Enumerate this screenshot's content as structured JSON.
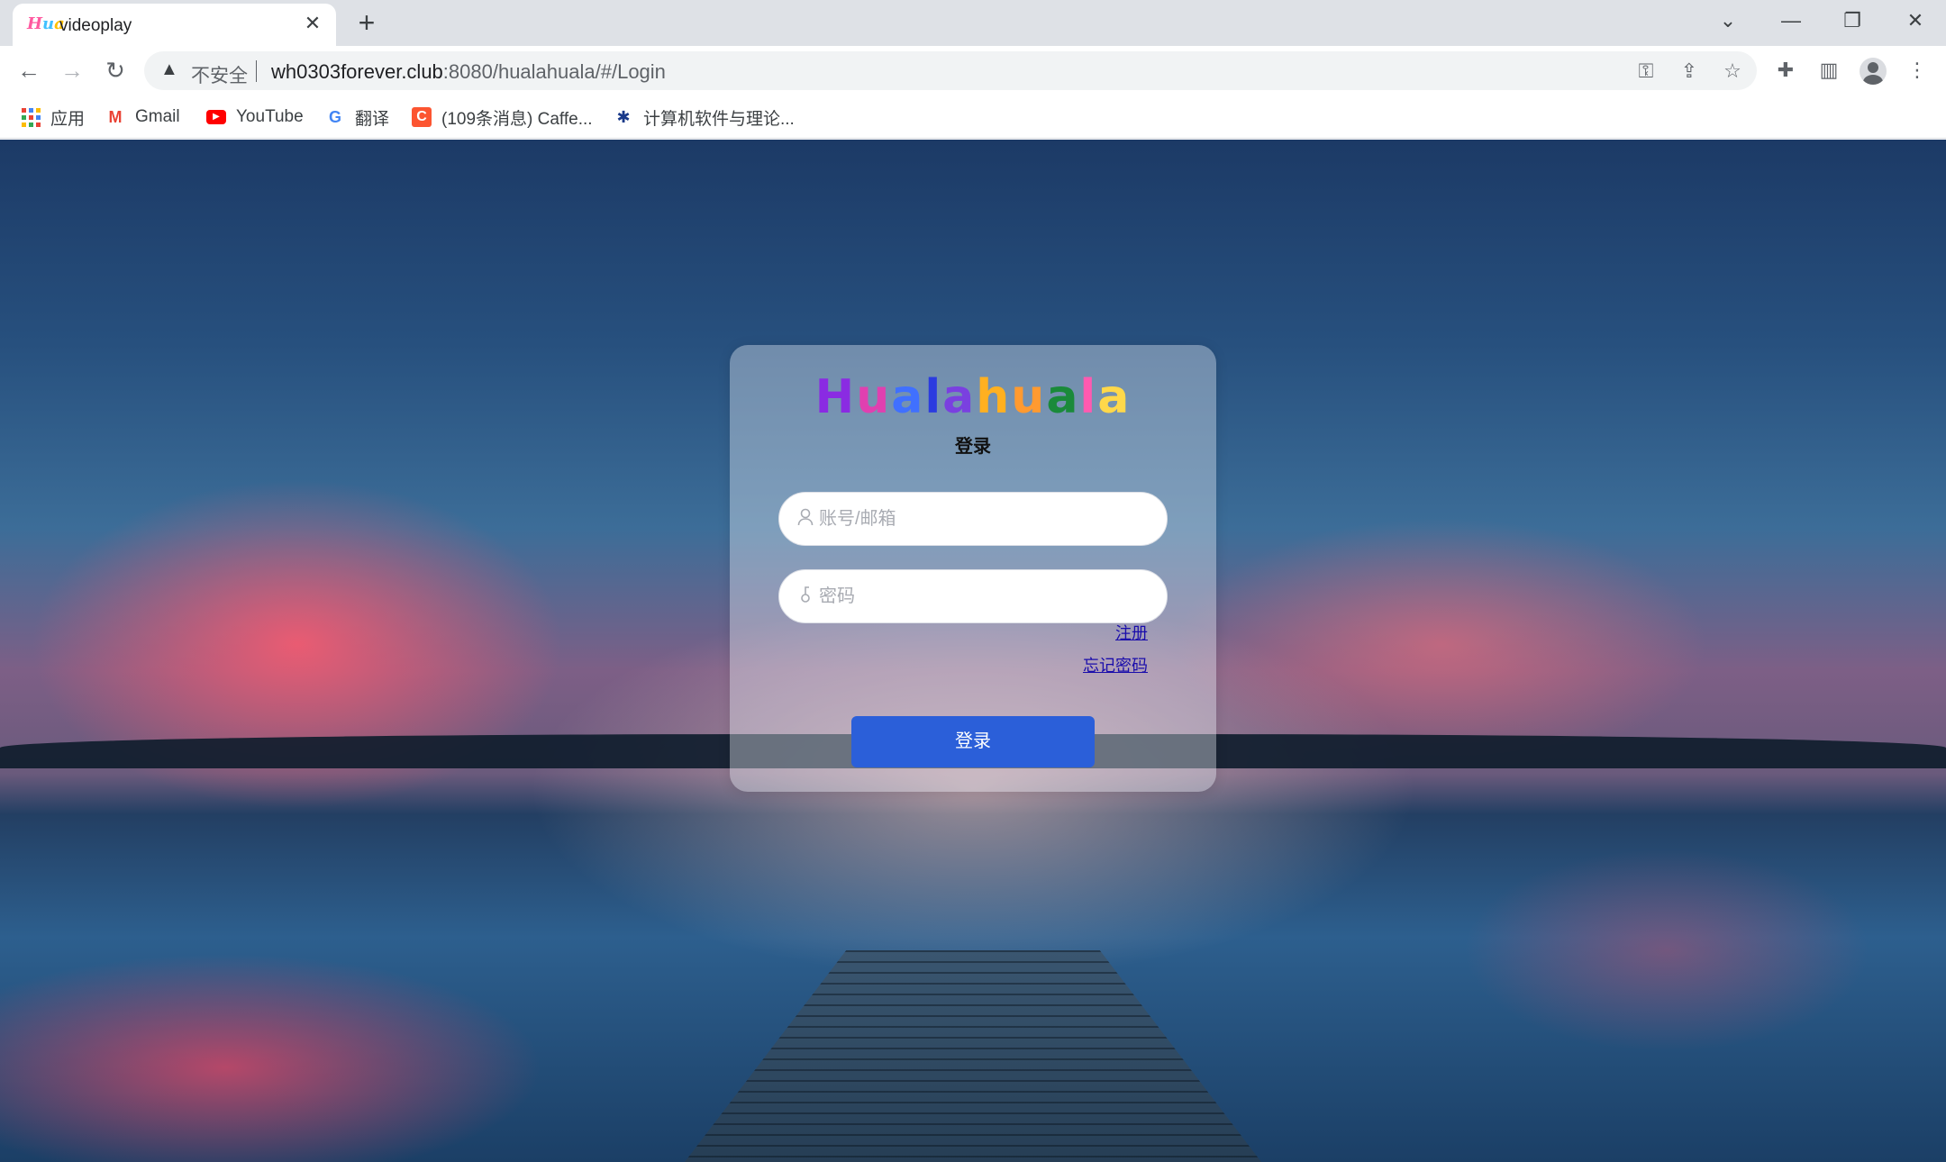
{
  "browser": {
    "tab": {
      "favicon_text": "Hua",
      "title": "videoplay",
      "close": "✕"
    },
    "new_tab": "+",
    "window_controls": {
      "dropdown": "⌄",
      "minimize": "—",
      "restore": "❐",
      "close": "✕"
    },
    "nav": {
      "back": "←",
      "forward": "→",
      "reload": "↻"
    },
    "address": {
      "security_label": "不安全",
      "url_host": "wh0303forever.club",
      "url_rest": ":8080/hualahuala/#/Login"
    },
    "bookmarks": [
      {
        "label": "应用",
        "icon": "apps-grid-icon"
      },
      {
        "label": "Gmail",
        "icon": "gmail-icon"
      },
      {
        "label": "YouTube",
        "icon": "youtube-icon"
      },
      {
        "label": "翻译",
        "icon": "translate-icon"
      },
      {
        "label": "(109条消息) Caffe...",
        "icon": "csdn-icon"
      },
      {
        "label": "计算机软件与理论...",
        "icon": "bookmark-site-icon"
      }
    ]
  },
  "login": {
    "logo_letters": [
      {
        "ch": "H",
        "color": "#8a2be2"
      },
      {
        "ch": "u",
        "color": "#e040b0"
      },
      {
        "ch": "a",
        "color": "#4070ff"
      },
      {
        "ch": "l",
        "color": "#2b3be0"
      },
      {
        "ch": "a",
        "color": "#7a40e0"
      },
      {
        "ch": "h",
        "color": "#ffb020"
      },
      {
        "ch": "u",
        "color": "#ff9a30"
      },
      {
        "ch": "a",
        "color": "#1a8a3a"
      },
      {
        "ch": "l",
        "color": "#ff5ab0"
      },
      {
        "ch": "a",
        "color": "#ffd84a"
      }
    ],
    "title": "登录",
    "username_placeholder": "账号/邮箱",
    "password_placeholder": "密码",
    "register_link": "注册",
    "forgot_link": "忘记密码",
    "submit_label": "登录",
    "accent_color": "#2b5fd9"
  }
}
